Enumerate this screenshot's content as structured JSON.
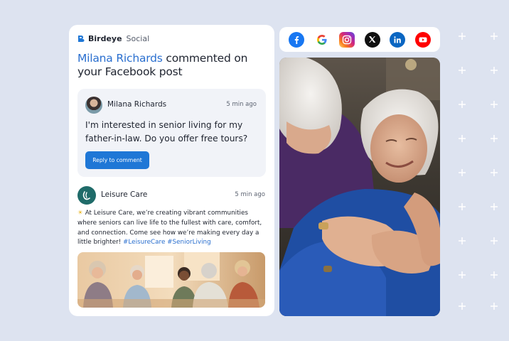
{
  "brand": {
    "name": "Birdeye",
    "product": "Social",
    "icon": "birdeye-logo-icon"
  },
  "notification": {
    "commenter_name": "Milana Richards",
    "headline_rest": "commented on your Facebook post"
  },
  "comment": {
    "author": "Milana Richards",
    "time": "5 min ago",
    "text": "I'm interested in senior living for my father-in-law. Do you offer free tours?",
    "reply_label": "Reply to comment"
  },
  "post": {
    "author": "Leisure Care",
    "time": "5 min ago",
    "emoji_icon": "sun-emoji-icon",
    "text": "At Leisure Care, we’re creating vibrant communities where seniors can live life to the fullest with care, comfort, and connection. Come see how we’re making every day a little brighter!",
    "hashtags": "#LeisureCare #SeniorLiving"
  },
  "social_networks": [
    {
      "name": "Facebook",
      "icon": "facebook-icon",
      "color": "#1877f2"
    },
    {
      "name": "Google",
      "icon": "google-icon",
      "color": "#4285f4"
    },
    {
      "name": "Instagram",
      "icon": "instagram-icon",
      "color": "#d62976"
    },
    {
      "name": "X",
      "icon": "x-icon",
      "color": "#111111"
    },
    {
      "name": "LinkedIn",
      "icon": "linkedin-icon",
      "color": "#0a66c2"
    },
    {
      "name": "YouTube",
      "icon": "youtube-icon",
      "color": "#ff0000"
    }
  ],
  "colors": {
    "background": "#dde3f0",
    "accent": "#2a6fcf",
    "button": "#1f77d6",
    "comment_box": "#f1f3f8",
    "avatar_brand": "#1f6b69"
  }
}
